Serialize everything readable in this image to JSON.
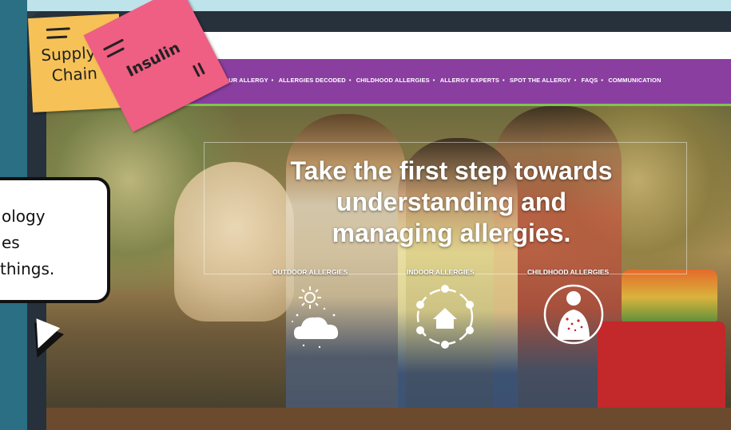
{
  "navbar": {
    "links": [
      "OW YOUR ALLERGY",
      "ALLERGIES DECODED",
      "CHILDHOOD ALLERGIES",
      "ALLERGY EXPERTS",
      "SPOT THE ALLERGY",
      "FAQS",
      "COMMUNICATION"
    ],
    "separator": "•",
    "color": "#8a3fa0",
    "accent": "#7fc454"
  },
  "hero": {
    "headline_lines": [
      "Take the first step towards",
      "understanding and",
      "managing allergies."
    ],
    "categories": [
      {
        "label": "OUTDOOR ALLERGIES",
        "icon": "cloud-sun-icon"
      },
      {
        "label": "INDOOR ALLERGIES",
        "icon": "house-cycle-icon"
      },
      {
        "label": "CHILDHOOD ALLERGIES",
        "icon": "child-rash-icon"
      }
    ]
  },
  "stickies": {
    "yellow": {
      "line1": "Supply",
      "line2": "Chain",
      "color": "#f6c257"
    },
    "pink": {
      "text": "Insulin",
      "color": "#ef5e83"
    }
  },
  "bubble": {
    "lines": [
      "ology",
      "es",
      "things."
    ]
  }
}
